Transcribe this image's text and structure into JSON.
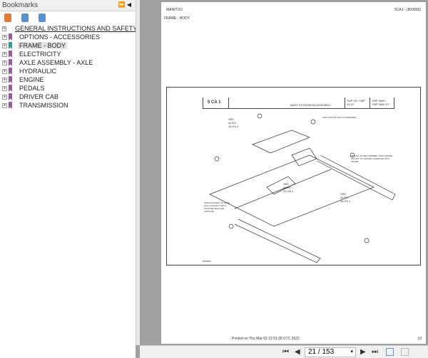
{
  "sidebar": {
    "title": "Bookmarks",
    "header_controls": "⏩ ◀",
    "tools": [
      "bookmark-icon",
      "bookmark-expand-icon",
      "bookmark-options-icon"
    ],
    "items": [
      {
        "label": "GENERAL INSTRUCTIONS AND SAFETY NOTICES"
      },
      {
        "label": "OPTIONS - ACCESSORIES"
      },
      {
        "label": "FRAME - BODY",
        "selected": true
      },
      {
        "label": "ELECTRICITY"
      },
      {
        "label": "AXLE ASSEMBLY - AXLE"
      },
      {
        "label": "HYDRAULIC"
      },
      {
        "label": "ENGINE"
      },
      {
        "label": "PEDALS"
      },
      {
        "label": "DRIVER CAB"
      },
      {
        "label": "TRANSMISSION"
      }
    ]
  },
  "page": {
    "brand": "MANITOU",
    "code": "5CA1 - (800806)",
    "section": "FRAME - BODY",
    "drawing": {
      "id": "5 CA 1",
      "title": "MAST EXTENSION ASSEMBLY",
      "models1": "TMP 25 / TMP 25 HT",
      "models2": "TMP 5500 / TMP 5500 HT",
      "see_also_1": "SEE ALSO: 16.G4.1",
      "see_also_2": "SEE ALSO: 10.G8.1",
      "see_also_3": "SEE ALSO: 16.G3.1",
      "note_1": "USE LOCTITE 243 TO ASSEMBLE",
      "note_2": "INSTALL AFTER ASSEMBLY INTO FRAME. ADJUST TO CENTER CARRIAGE INTO FRAME.",
      "note_3": "SHIM ROLLERS TO HAVE FULL CONTACT WITH CHANNEL ROLLING SURFACE",
      "ref": "800806A"
    },
    "footer_printed": "Printed on  Thu Mar 03 12:51:39 UTC 2022",
    "page_number": "13"
  },
  "toolbar": {
    "first": "⏮",
    "prev": "◀",
    "page_value": "21 / 153",
    "next": "▶",
    "last": "⏭"
  }
}
